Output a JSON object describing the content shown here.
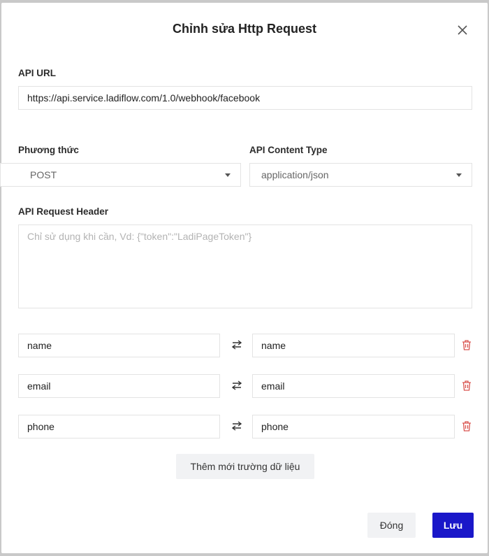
{
  "dialog": {
    "title": "Chỉnh sửa Http Request",
    "close_icon": "close-icon"
  },
  "api_url": {
    "label": "API URL",
    "value": "https://api.service.ladiflow.com/1.0/webhook/facebook"
  },
  "method": {
    "label": "Phương thức",
    "selected": "POST"
  },
  "content_type": {
    "label": "API Content Type",
    "selected": "application/json"
  },
  "request_header": {
    "label": "API Request Header",
    "placeholder": "Chỉ sử dụng khi cần, Vd: {\"token\":\"LadiPageToken\"}"
  },
  "field_mappings": [
    {
      "source": "name",
      "target": "name"
    },
    {
      "source": "email",
      "target": "email"
    },
    {
      "source": "phone",
      "target": "phone"
    }
  ],
  "buttons": {
    "add_field": "Thêm mới trường dữ liệu",
    "close": "Đóng",
    "save": "Lưu"
  },
  "colors": {
    "primary": "#1a17c9",
    "delete": "#d9534f",
    "secondary_button_bg": "#f1f2f4"
  }
}
